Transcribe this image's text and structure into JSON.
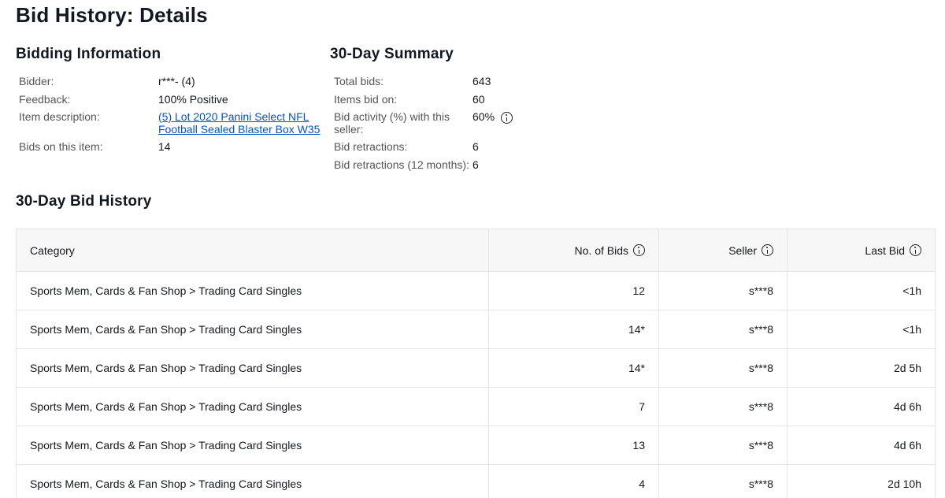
{
  "page_title": "Bid History: Details",
  "bidding_information": {
    "title": "Bidding Information",
    "bidder_label": "Bidder:",
    "bidder_value": "r***- (4)",
    "feedback_label": "Feedback:",
    "feedback_value": "100% Positive",
    "item_description_label": "Item description:",
    "item_description_line1": "(5) Lot 2020 Panini Select NFL",
    "item_description_line2": "Football Sealed Blaster Box W35",
    "bids_on_item_label": "Bids on this item:",
    "bids_on_item_value": "14"
  },
  "summary": {
    "title": "30-Day Summary",
    "total_bids_label": "Total bids:",
    "total_bids_value": "643",
    "items_bid_on_label": "Items bid on:",
    "items_bid_on_value": "60",
    "bid_activity_label_line1": "Bid activity (%) with this",
    "bid_activity_label_line2": "seller:",
    "bid_activity_value": "60%",
    "bid_retractions_label": "Bid retractions:",
    "bid_retractions_value": "6",
    "bid_retractions_12m_label": "Bid retractions (12 months):",
    "bid_retractions_12m_value": "6"
  },
  "history": {
    "title": "30-Day Bid History",
    "columns": {
      "category": "Category",
      "num_bids": "No. of Bids",
      "seller": "Seller",
      "last_bid": "Last Bid"
    },
    "rows": [
      {
        "category": "Sports Mem, Cards & Fan Shop > Trading Card Singles",
        "num_bids": "12",
        "seller": "s***8",
        "last_bid": "<1h"
      },
      {
        "category": "Sports Mem, Cards & Fan Shop > Trading Card Singles",
        "num_bids": "14*",
        "seller": "s***8",
        "last_bid": "<1h"
      },
      {
        "category": "Sports Mem, Cards & Fan Shop > Trading Card Singles",
        "num_bids": "14*",
        "seller": "s***8",
        "last_bid": "2d 5h"
      },
      {
        "category": "Sports Mem, Cards & Fan Shop > Trading Card Singles",
        "num_bids": "7",
        "seller": "s***8",
        "last_bid": "4d 6h"
      },
      {
        "category": "Sports Mem, Cards & Fan Shop > Trading Card Singles",
        "num_bids": "13",
        "seller": "s***8",
        "last_bid": "4d 6h"
      },
      {
        "category": "Sports Mem, Cards & Fan Shop > Trading Card Singles",
        "num_bids": "4",
        "seller": "s***8",
        "last_bid": "2d 10h"
      }
    ]
  },
  "colors": {
    "link": "#0654ba",
    "label_gray": "#555555",
    "header_bg": "#f7f7f7",
    "border": "#e5e5e5"
  },
  "icons": {
    "info": "info-circle-icon"
  }
}
